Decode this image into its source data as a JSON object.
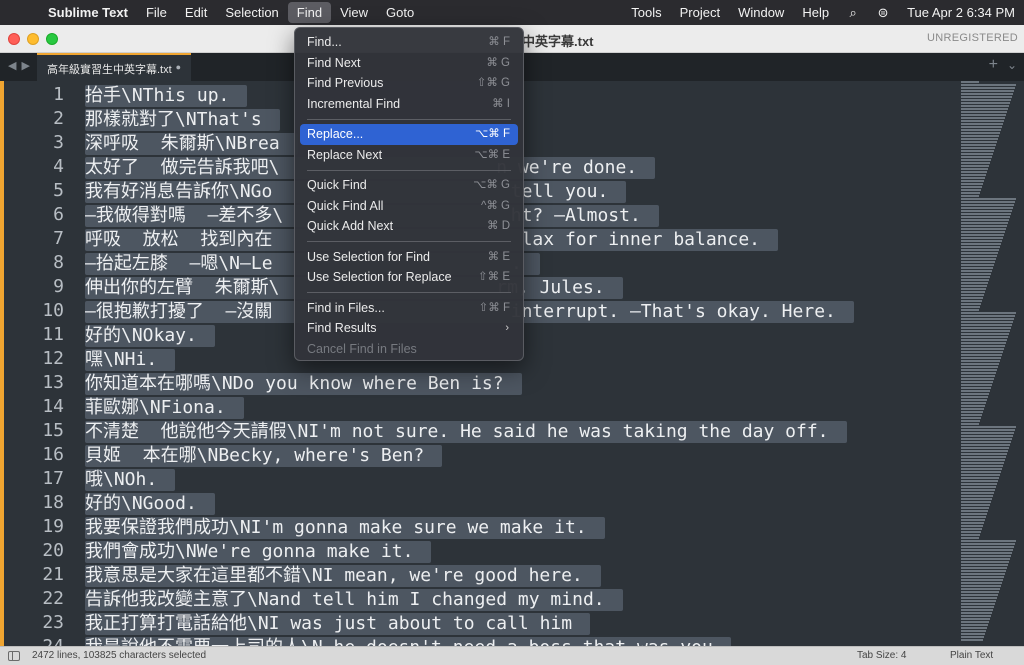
{
  "menubar": {
    "apple_glyph": "",
    "app_name": "Sublime Text",
    "items": [
      "File",
      "Edit",
      "Selection",
      "Find",
      "View",
      "Goto"
    ],
    "active": "Find",
    "right_items": [
      "Tools",
      "Project",
      "Window",
      "Help"
    ],
    "search_glyph": "⌕",
    "control_glyph": "⊜",
    "datetime": "Tue Apr 2  6:34 PM"
  },
  "window": {
    "title": "中英字幕.txt",
    "unregistered": "UNREGISTERED"
  },
  "tabs": [
    {
      "label": "高年級實習生中英字幕.txt",
      "modified_glyph": "●"
    }
  ],
  "tabbar": {
    "back": "◀",
    "forward": "▶",
    "new_tab": "+",
    "overflow": "⌄"
  },
  "editor": {
    "lines": [
      {
        "n": "1",
        "text": "抬手\\NThis up."
      },
      {
        "n": "2",
        "text": "那樣就對了\\NThat's"
      },
      {
        "n": "3",
        "text": "深呼吸  朱爾斯\\NBrea"
      },
      {
        "n": "4",
        "text": "太好了  做完告訴我吧\\                    n we're done."
      },
      {
        "n": "5",
        "text": "我有好消息告訴你\\NGo                      tell you."
      },
      {
        "n": "6",
        "text": "—我做得對嗎  —差不多\\                     ht? —Almost."
      },
      {
        "n": "7",
        "text": "呼吸  放松  找到內在                       lax for inner balance."
      },
      {
        "n": "8",
        "text": "—抬起左膝  —嗯\\N—Le                      ."
      },
      {
        "n": "9",
        "text": "伸出你的左臂  朱爾斯\\                    rm, Jules."
      },
      {
        "n": "10",
        "text": "—很抱歉打擾了  —沒關                      interrupt. —That's okay. Here."
      },
      {
        "n": "11",
        "text": "好的\\NOkay."
      },
      {
        "n": "12",
        "text": "嘿\\NHi."
      },
      {
        "n": "13",
        "text": "你知道本在哪嗎\\NDo you know where Ben is?"
      },
      {
        "n": "14",
        "text": "菲歐娜\\NFiona."
      },
      {
        "n": "15",
        "text": "不清楚  他說他今天請假\\NI'm not sure. He said he was taking the day off."
      },
      {
        "n": "16",
        "text": "貝姬  本在哪\\NBecky, where's Ben?"
      },
      {
        "n": "17",
        "text": "哦\\NOh."
      },
      {
        "n": "18",
        "text": "好的\\NGood."
      },
      {
        "n": "19",
        "text": "我要保證我們成功\\NI'm gonna make sure we make it."
      },
      {
        "n": "20",
        "text": "我們會成功\\NWe're gonna make it."
      },
      {
        "n": "21",
        "text": "我意思是大家在這里都不錯\\NI mean, we're good here."
      },
      {
        "n": "22",
        "text": "告訴他我改變主意了\\Nand tell him I changed my mind."
      },
      {
        "n": "23",
        "text": "我正打算打電話給他\\NI was just about to call him"
      },
      {
        "n": "24",
        "text": "我是說他不需要一上司的人\\N he doesn't need a boss that was you"
      }
    ]
  },
  "find_menu": {
    "items": [
      {
        "label": "Find...",
        "shortcut": "⌘ F"
      },
      {
        "label": "Find Next",
        "shortcut": "⌘ G"
      },
      {
        "label": "Find Previous",
        "shortcut": "⇧⌘ G"
      },
      {
        "label": "Incremental Find",
        "shortcut": "⌘ I"
      },
      {
        "label": "Replace...",
        "shortcut": "⌥⌘ F"
      },
      {
        "label": "Replace Next",
        "shortcut": "⌥⌘ E"
      },
      {
        "label": "Quick Find",
        "shortcut": "⌥⌘ G"
      },
      {
        "label": "Quick Find All",
        "shortcut": "^⌘ G"
      },
      {
        "label": "Quick Add Next",
        "shortcut": "⌘ D"
      },
      {
        "label": "Use Selection for Find",
        "shortcut": "⌘ E"
      },
      {
        "label": "Use Selection for Replace",
        "shortcut": "⇧⌘ E"
      },
      {
        "label": "Find in Files...",
        "shortcut": "⇧⌘ F"
      },
      {
        "label": "Find Results",
        "arrow": "›"
      },
      {
        "label": "Cancel Find in Files"
      }
    ],
    "highlighted": "Replace...",
    "disabled": "Cancel Find in Files"
  },
  "statusbar": {
    "selection": "2472 lines, 103825 characters selected",
    "tab_size": "Tab Size: 4",
    "syntax": "Plain Text"
  },
  "colors": {
    "accent": "#f0a531",
    "editor_bg": "#2d3339",
    "selection": "#4d5661",
    "menu_highlight": "#2f63d3"
  }
}
